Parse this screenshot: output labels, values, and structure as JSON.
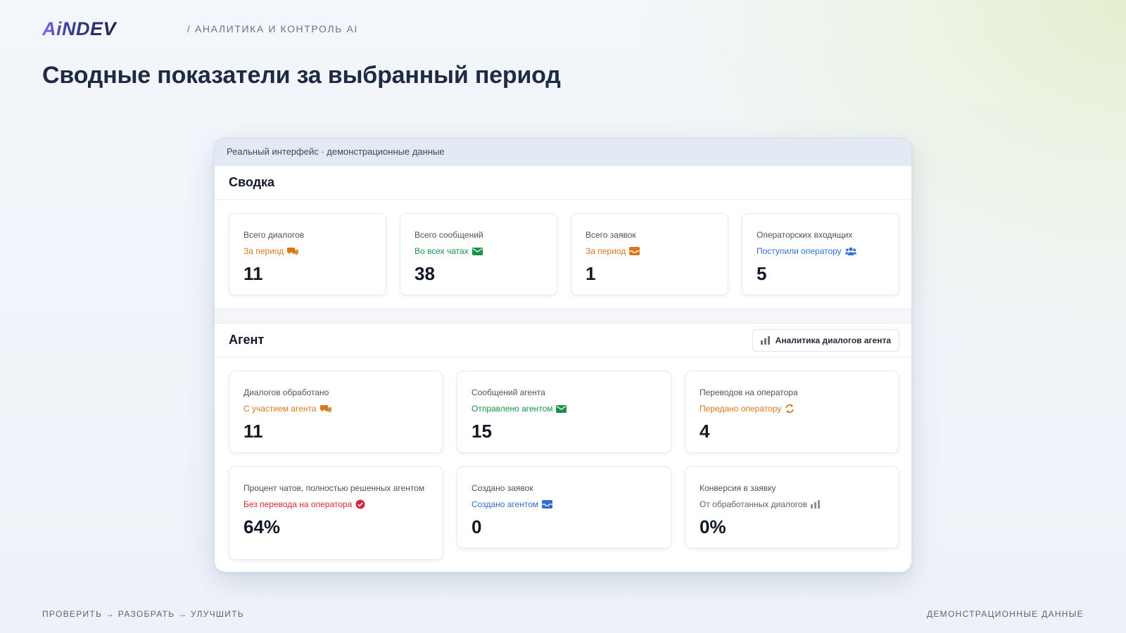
{
  "header": {
    "logo_text": "AiNDEV",
    "breadcrumb": "/ АНАЛИТИКА И КОНТРОЛЬ AI",
    "title": "Сводные показатели за выбранный период"
  },
  "frame": {
    "caption": "Реальный интерфейс · демонстрационные данные"
  },
  "summary": {
    "title": "Сводка",
    "cards": [
      {
        "label": "Всего диалогов",
        "sub": "За период",
        "value": "11",
        "icon": "comments-icon",
        "color": "#d9771f"
      },
      {
        "label": "Всего сообщений",
        "sub": "Во всех чатах",
        "value": "38",
        "icon": "envelope-icon",
        "color": "#18924a"
      },
      {
        "label": "Всего заявок",
        "sub": "За период",
        "value": "1",
        "icon": "inbox-icon",
        "color": "#d9771f"
      },
      {
        "label": "Операторских входящих",
        "sub": "Поступили оператору",
        "value": "5",
        "icon": "users-icon",
        "color": "#2f6fd1"
      }
    ]
  },
  "agent": {
    "title": "Агент",
    "analytics_button": "Аналитика диалогов агента",
    "cards": [
      {
        "label": "Диалогов обработано",
        "sub": "С участием агента",
        "value": "11",
        "icon": "comments-icon",
        "color": "#d9771f"
      },
      {
        "label": "Сообщений агента",
        "sub": "Отправлено агентом",
        "value": "15",
        "icon": "envelope-icon",
        "color": "#18924a"
      },
      {
        "label": "Переводов на оператора",
        "sub": "Передано оператору",
        "value": "4",
        "icon": "sync-icon",
        "color": "#d9771f"
      },
      {
        "label": "Процент чатов, полностью решенных агентом",
        "sub": "Без перевода на оператора",
        "value": "64%",
        "icon": "check-badge-icon",
        "color": "#d6263a"
      },
      {
        "label": "Создано заявок",
        "sub": "Создано агентом",
        "value": "0",
        "icon": "inbox-icon",
        "color": "#2f6fd1"
      },
      {
        "label": "Конверсия в заявку",
        "sub": "От обработанных диалогов",
        "value": "0%",
        "icon": "bar-chart-icon",
        "color": "#5b6372"
      }
    ]
  },
  "footer": {
    "left": "ПРОВЕРИТЬ → РАЗОБРАТЬ → УЛУЧШИТЬ",
    "right": "ДЕМОНСТРАЦИОННЫЕ ДАННЫЕ"
  }
}
